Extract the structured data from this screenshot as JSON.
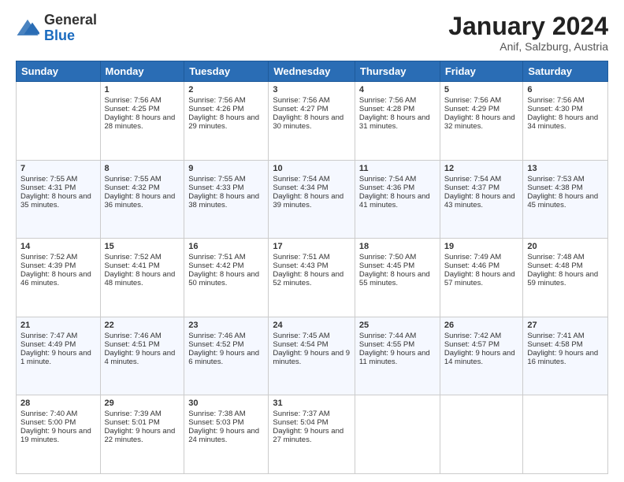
{
  "logo": {
    "general": "General",
    "blue": "Blue"
  },
  "header": {
    "month": "January 2024",
    "location": "Anif, Salzburg, Austria"
  },
  "weekdays": [
    "Sunday",
    "Monday",
    "Tuesday",
    "Wednesday",
    "Thursday",
    "Friday",
    "Saturday"
  ],
  "weeks": [
    [
      {
        "day": "",
        "sunrise": "",
        "sunset": "",
        "daylight": ""
      },
      {
        "day": "1",
        "sunrise": "Sunrise: 7:56 AM",
        "sunset": "Sunset: 4:25 PM",
        "daylight": "Daylight: 8 hours and 28 minutes."
      },
      {
        "day": "2",
        "sunrise": "Sunrise: 7:56 AM",
        "sunset": "Sunset: 4:26 PM",
        "daylight": "Daylight: 8 hours and 29 minutes."
      },
      {
        "day": "3",
        "sunrise": "Sunrise: 7:56 AM",
        "sunset": "Sunset: 4:27 PM",
        "daylight": "Daylight: 8 hours and 30 minutes."
      },
      {
        "day": "4",
        "sunrise": "Sunrise: 7:56 AM",
        "sunset": "Sunset: 4:28 PM",
        "daylight": "Daylight: 8 hours and 31 minutes."
      },
      {
        "day": "5",
        "sunrise": "Sunrise: 7:56 AM",
        "sunset": "Sunset: 4:29 PM",
        "daylight": "Daylight: 8 hours and 32 minutes."
      },
      {
        "day": "6",
        "sunrise": "Sunrise: 7:56 AM",
        "sunset": "Sunset: 4:30 PM",
        "daylight": "Daylight: 8 hours and 34 minutes."
      }
    ],
    [
      {
        "day": "7",
        "sunrise": "Sunrise: 7:55 AM",
        "sunset": "Sunset: 4:31 PM",
        "daylight": "Daylight: 8 hours and 35 minutes."
      },
      {
        "day": "8",
        "sunrise": "Sunrise: 7:55 AM",
        "sunset": "Sunset: 4:32 PM",
        "daylight": "Daylight: 8 hours and 36 minutes."
      },
      {
        "day": "9",
        "sunrise": "Sunrise: 7:55 AM",
        "sunset": "Sunset: 4:33 PM",
        "daylight": "Daylight: 8 hours and 38 minutes."
      },
      {
        "day": "10",
        "sunrise": "Sunrise: 7:54 AM",
        "sunset": "Sunset: 4:34 PM",
        "daylight": "Daylight: 8 hours and 39 minutes."
      },
      {
        "day": "11",
        "sunrise": "Sunrise: 7:54 AM",
        "sunset": "Sunset: 4:36 PM",
        "daylight": "Daylight: 8 hours and 41 minutes."
      },
      {
        "day": "12",
        "sunrise": "Sunrise: 7:54 AM",
        "sunset": "Sunset: 4:37 PM",
        "daylight": "Daylight: 8 hours and 43 minutes."
      },
      {
        "day": "13",
        "sunrise": "Sunrise: 7:53 AM",
        "sunset": "Sunset: 4:38 PM",
        "daylight": "Daylight: 8 hours and 45 minutes."
      }
    ],
    [
      {
        "day": "14",
        "sunrise": "Sunrise: 7:52 AM",
        "sunset": "Sunset: 4:39 PM",
        "daylight": "Daylight: 8 hours and 46 minutes."
      },
      {
        "day": "15",
        "sunrise": "Sunrise: 7:52 AM",
        "sunset": "Sunset: 4:41 PM",
        "daylight": "Daylight: 8 hours and 48 minutes."
      },
      {
        "day": "16",
        "sunrise": "Sunrise: 7:51 AM",
        "sunset": "Sunset: 4:42 PM",
        "daylight": "Daylight: 8 hours and 50 minutes."
      },
      {
        "day": "17",
        "sunrise": "Sunrise: 7:51 AM",
        "sunset": "Sunset: 4:43 PM",
        "daylight": "Daylight: 8 hours and 52 minutes."
      },
      {
        "day": "18",
        "sunrise": "Sunrise: 7:50 AM",
        "sunset": "Sunset: 4:45 PM",
        "daylight": "Daylight: 8 hours and 55 minutes."
      },
      {
        "day": "19",
        "sunrise": "Sunrise: 7:49 AM",
        "sunset": "Sunset: 4:46 PM",
        "daylight": "Daylight: 8 hours and 57 minutes."
      },
      {
        "day": "20",
        "sunrise": "Sunrise: 7:48 AM",
        "sunset": "Sunset: 4:48 PM",
        "daylight": "Daylight: 8 hours and 59 minutes."
      }
    ],
    [
      {
        "day": "21",
        "sunrise": "Sunrise: 7:47 AM",
        "sunset": "Sunset: 4:49 PM",
        "daylight": "Daylight: 9 hours and 1 minute."
      },
      {
        "day": "22",
        "sunrise": "Sunrise: 7:46 AM",
        "sunset": "Sunset: 4:51 PM",
        "daylight": "Daylight: 9 hours and 4 minutes."
      },
      {
        "day": "23",
        "sunrise": "Sunrise: 7:46 AM",
        "sunset": "Sunset: 4:52 PM",
        "daylight": "Daylight: 9 hours and 6 minutes."
      },
      {
        "day": "24",
        "sunrise": "Sunrise: 7:45 AM",
        "sunset": "Sunset: 4:54 PM",
        "daylight": "Daylight: 9 hours and 9 minutes."
      },
      {
        "day": "25",
        "sunrise": "Sunrise: 7:44 AM",
        "sunset": "Sunset: 4:55 PM",
        "daylight": "Daylight: 9 hours and 11 minutes."
      },
      {
        "day": "26",
        "sunrise": "Sunrise: 7:42 AM",
        "sunset": "Sunset: 4:57 PM",
        "daylight": "Daylight: 9 hours and 14 minutes."
      },
      {
        "day": "27",
        "sunrise": "Sunrise: 7:41 AM",
        "sunset": "Sunset: 4:58 PM",
        "daylight": "Daylight: 9 hours and 16 minutes."
      }
    ],
    [
      {
        "day": "28",
        "sunrise": "Sunrise: 7:40 AM",
        "sunset": "Sunset: 5:00 PM",
        "daylight": "Daylight: 9 hours and 19 minutes."
      },
      {
        "day": "29",
        "sunrise": "Sunrise: 7:39 AM",
        "sunset": "Sunset: 5:01 PM",
        "daylight": "Daylight: 9 hours and 22 minutes."
      },
      {
        "day": "30",
        "sunrise": "Sunrise: 7:38 AM",
        "sunset": "Sunset: 5:03 PM",
        "daylight": "Daylight: 9 hours and 24 minutes."
      },
      {
        "day": "31",
        "sunrise": "Sunrise: 7:37 AM",
        "sunset": "Sunset: 5:04 PM",
        "daylight": "Daylight: 9 hours and 27 minutes."
      },
      {
        "day": "",
        "sunrise": "",
        "sunset": "",
        "daylight": ""
      },
      {
        "day": "",
        "sunrise": "",
        "sunset": "",
        "daylight": ""
      },
      {
        "day": "",
        "sunrise": "",
        "sunset": "",
        "daylight": ""
      }
    ]
  ]
}
